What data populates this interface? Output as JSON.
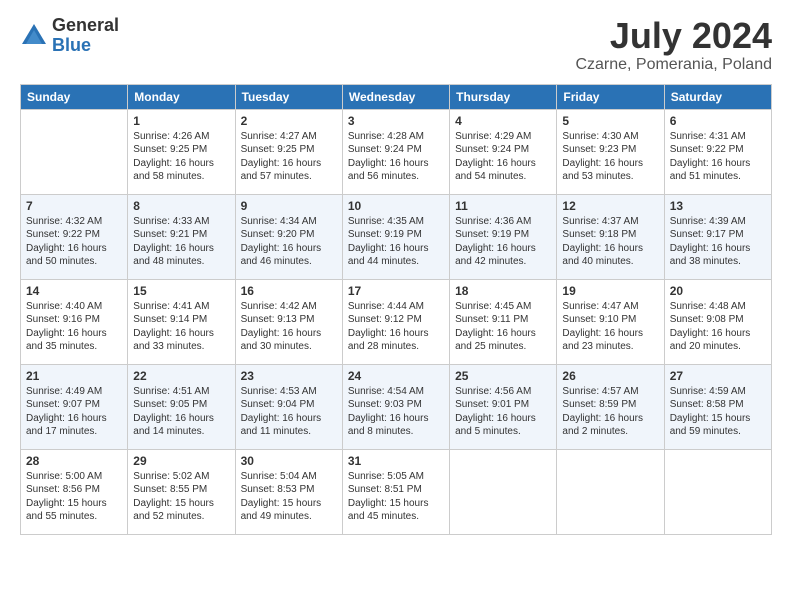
{
  "logo": {
    "general": "General",
    "blue": "Blue"
  },
  "header": {
    "month_year": "July 2024",
    "location": "Czarne, Pomerania, Poland"
  },
  "days_of_week": [
    "Sunday",
    "Monday",
    "Tuesday",
    "Wednesday",
    "Thursday",
    "Friday",
    "Saturday"
  ],
  "weeks": [
    [
      {
        "day": "",
        "info": ""
      },
      {
        "day": "1",
        "info": "Sunrise: 4:26 AM\nSunset: 9:25 PM\nDaylight: 16 hours\nand 58 minutes."
      },
      {
        "day": "2",
        "info": "Sunrise: 4:27 AM\nSunset: 9:25 PM\nDaylight: 16 hours\nand 57 minutes."
      },
      {
        "day": "3",
        "info": "Sunrise: 4:28 AM\nSunset: 9:24 PM\nDaylight: 16 hours\nand 56 minutes."
      },
      {
        "day": "4",
        "info": "Sunrise: 4:29 AM\nSunset: 9:24 PM\nDaylight: 16 hours\nand 54 minutes."
      },
      {
        "day": "5",
        "info": "Sunrise: 4:30 AM\nSunset: 9:23 PM\nDaylight: 16 hours\nand 53 minutes."
      },
      {
        "day": "6",
        "info": "Sunrise: 4:31 AM\nSunset: 9:22 PM\nDaylight: 16 hours\nand 51 minutes."
      }
    ],
    [
      {
        "day": "7",
        "info": "Sunrise: 4:32 AM\nSunset: 9:22 PM\nDaylight: 16 hours\nand 50 minutes."
      },
      {
        "day": "8",
        "info": "Sunrise: 4:33 AM\nSunset: 9:21 PM\nDaylight: 16 hours\nand 48 minutes."
      },
      {
        "day": "9",
        "info": "Sunrise: 4:34 AM\nSunset: 9:20 PM\nDaylight: 16 hours\nand 46 minutes."
      },
      {
        "day": "10",
        "info": "Sunrise: 4:35 AM\nSunset: 9:19 PM\nDaylight: 16 hours\nand 44 minutes."
      },
      {
        "day": "11",
        "info": "Sunrise: 4:36 AM\nSunset: 9:19 PM\nDaylight: 16 hours\nand 42 minutes."
      },
      {
        "day": "12",
        "info": "Sunrise: 4:37 AM\nSunset: 9:18 PM\nDaylight: 16 hours\nand 40 minutes."
      },
      {
        "day": "13",
        "info": "Sunrise: 4:39 AM\nSunset: 9:17 PM\nDaylight: 16 hours\nand 38 minutes."
      }
    ],
    [
      {
        "day": "14",
        "info": "Sunrise: 4:40 AM\nSunset: 9:16 PM\nDaylight: 16 hours\nand 35 minutes."
      },
      {
        "day": "15",
        "info": "Sunrise: 4:41 AM\nSunset: 9:14 PM\nDaylight: 16 hours\nand 33 minutes."
      },
      {
        "day": "16",
        "info": "Sunrise: 4:42 AM\nSunset: 9:13 PM\nDaylight: 16 hours\nand 30 minutes."
      },
      {
        "day": "17",
        "info": "Sunrise: 4:44 AM\nSunset: 9:12 PM\nDaylight: 16 hours\nand 28 minutes."
      },
      {
        "day": "18",
        "info": "Sunrise: 4:45 AM\nSunset: 9:11 PM\nDaylight: 16 hours\nand 25 minutes."
      },
      {
        "day": "19",
        "info": "Sunrise: 4:47 AM\nSunset: 9:10 PM\nDaylight: 16 hours\nand 23 minutes."
      },
      {
        "day": "20",
        "info": "Sunrise: 4:48 AM\nSunset: 9:08 PM\nDaylight: 16 hours\nand 20 minutes."
      }
    ],
    [
      {
        "day": "21",
        "info": "Sunrise: 4:49 AM\nSunset: 9:07 PM\nDaylight: 16 hours\nand 17 minutes."
      },
      {
        "day": "22",
        "info": "Sunrise: 4:51 AM\nSunset: 9:05 PM\nDaylight: 16 hours\nand 14 minutes."
      },
      {
        "day": "23",
        "info": "Sunrise: 4:53 AM\nSunset: 9:04 PM\nDaylight: 16 hours\nand 11 minutes."
      },
      {
        "day": "24",
        "info": "Sunrise: 4:54 AM\nSunset: 9:03 PM\nDaylight: 16 hours\nand 8 minutes."
      },
      {
        "day": "25",
        "info": "Sunrise: 4:56 AM\nSunset: 9:01 PM\nDaylight: 16 hours\nand 5 minutes."
      },
      {
        "day": "26",
        "info": "Sunrise: 4:57 AM\nSunset: 8:59 PM\nDaylight: 16 hours\nand 2 minutes."
      },
      {
        "day": "27",
        "info": "Sunrise: 4:59 AM\nSunset: 8:58 PM\nDaylight: 15 hours\nand 59 minutes."
      }
    ],
    [
      {
        "day": "28",
        "info": "Sunrise: 5:00 AM\nSunset: 8:56 PM\nDaylight: 15 hours\nand 55 minutes."
      },
      {
        "day": "29",
        "info": "Sunrise: 5:02 AM\nSunset: 8:55 PM\nDaylight: 15 hours\nand 52 minutes."
      },
      {
        "day": "30",
        "info": "Sunrise: 5:04 AM\nSunset: 8:53 PM\nDaylight: 15 hours\nand 49 minutes."
      },
      {
        "day": "31",
        "info": "Sunrise: 5:05 AM\nSunset: 8:51 PM\nDaylight: 15 hours\nand 45 minutes."
      },
      {
        "day": "",
        "info": ""
      },
      {
        "day": "",
        "info": ""
      },
      {
        "day": "",
        "info": ""
      }
    ]
  ]
}
